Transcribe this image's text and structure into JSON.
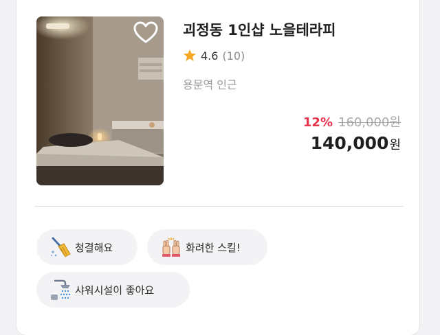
{
  "listing": {
    "title": "괴정동 1인샵 노을테라피",
    "rating": "4.6",
    "review_count": "(10)",
    "location": "용문역 인근",
    "discount": "12%",
    "original_price": "160,000원",
    "final_price": "140,000",
    "currency": "원",
    "favorite": false
  },
  "tags": [
    {
      "label": "청결해요",
      "icon": "broom-icon"
    },
    {
      "label": "화려한 스킬!",
      "icon": "hands-icon"
    },
    {
      "label": "샤워시설이 좋아요",
      "icon": "shower-icon"
    }
  ],
  "colors": {
    "discount": "#e8324b",
    "star": "#f5a623",
    "tag_background": "#f3f3f6",
    "title": "#1f1f1f"
  }
}
